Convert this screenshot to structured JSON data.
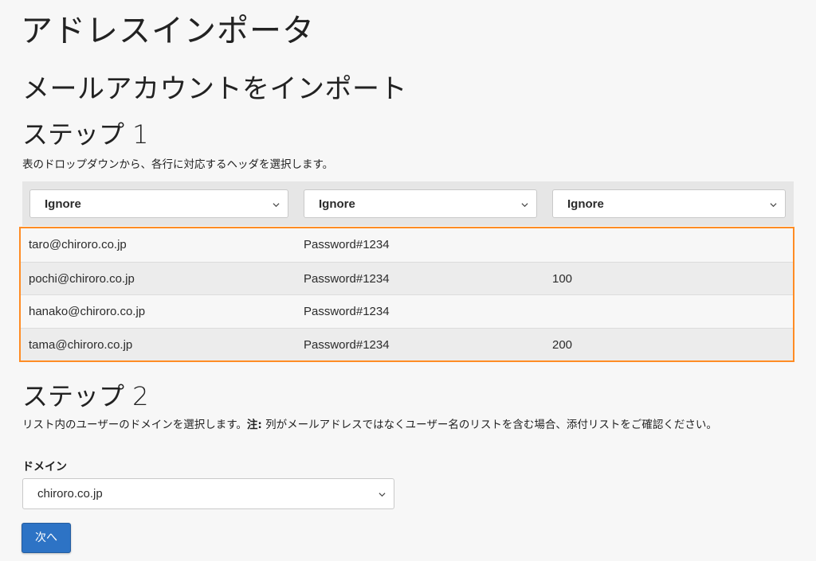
{
  "page_title": "アドレスインポータ",
  "section_title": "メールアカウントをインポート",
  "step1": {
    "heading": "ステップ 1",
    "description": "表のドロップダウンから、各行に対応するヘッダを選択します。",
    "column_selects": [
      "Ignore",
      "Ignore",
      "Ignore"
    ],
    "rows": [
      [
        "taro@chiroro.co.jp",
        "Password#1234",
        ""
      ],
      [
        "pochi@chiroro.co.jp",
        "Password#1234",
        "100"
      ],
      [
        "hanako@chiroro.co.jp",
        "Password#1234",
        ""
      ],
      [
        "tama@chiroro.co.jp",
        "Password#1234",
        "200"
      ]
    ],
    "highlight_color": "#ff8c24"
  },
  "step2": {
    "heading": "ステップ 2",
    "description_pre": "リスト内のユーザーのドメインを選択します。",
    "note_label": "注:",
    "description_post": " 列がメールアドレスではなくユーザー名のリストを含む場合、添付リストをご確認ください。",
    "domain_label": "ドメイン",
    "domain_value": "chiroro.co.jp"
  },
  "next_button": "次へ",
  "colors": {
    "primary_button": "#2d73c5"
  }
}
